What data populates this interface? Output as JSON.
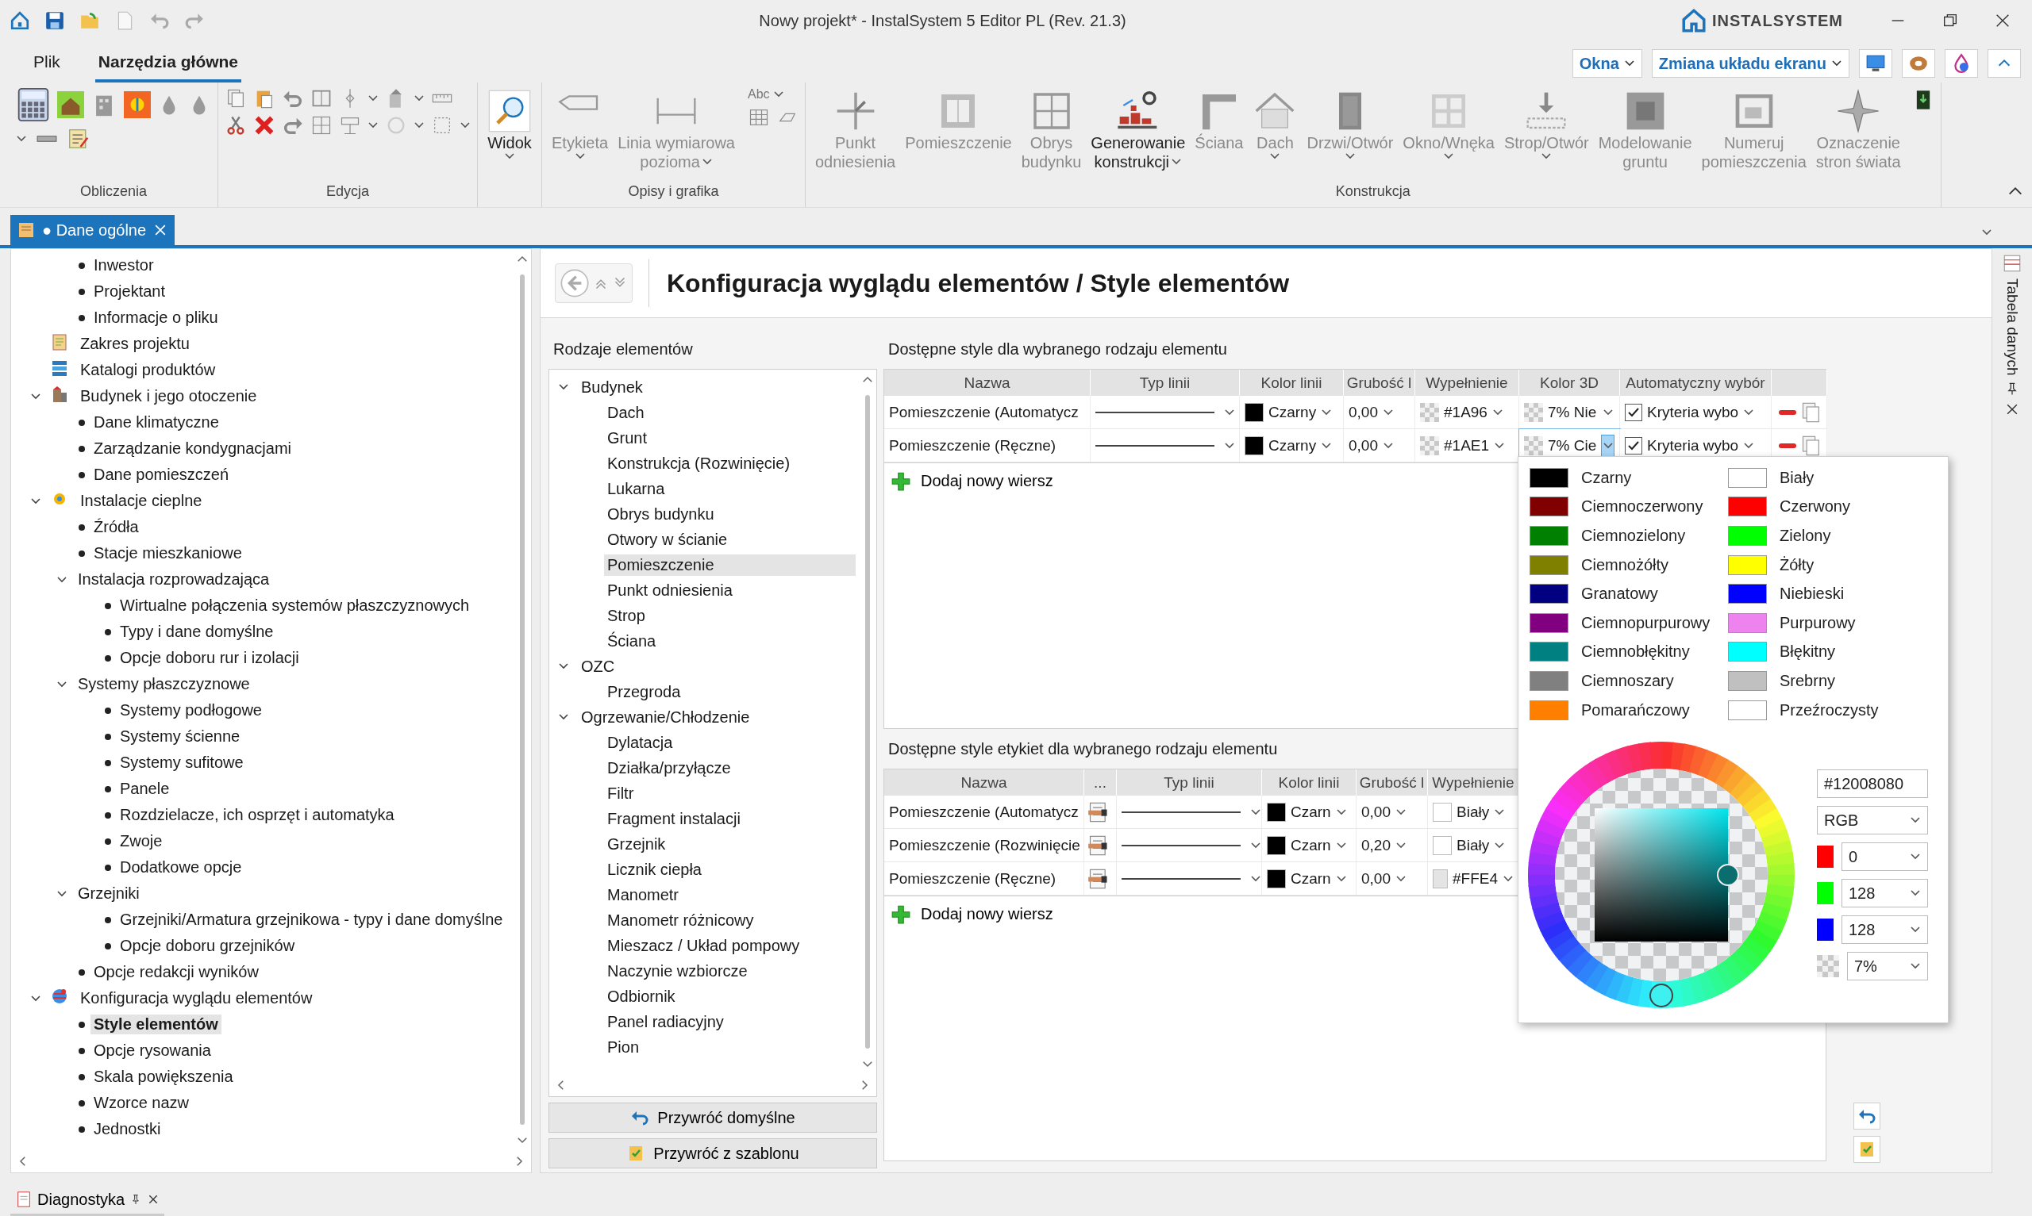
{
  "window": {
    "title": "Nowy projekt* - InstalSystem 5 Editor PL (Rev. 21.3)",
    "brand": "INSTALSYSTEM"
  },
  "menu_tabs": [
    {
      "label": "Plik",
      "selected": false
    },
    {
      "label": "Narzędzia główne",
      "selected": true
    }
  ],
  "ribbon_dropdowns": [
    {
      "label": "Okna"
    },
    {
      "label": "Zmiana układu ekranu"
    }
  ],
  "ribbon_groups": [
    {
      "kind": "calculations",
      "label": "Obliczenia"
    },
    {
      "kind": "editing",
      "label": "Edycja"
    },
    {
      "kind": "view",
      "buttons": [
        {
          "lines": [
            "Widok"
          ],
          "disabled": false,
          "dropdown": true
        }
      ]
    },
    {
      "kind": "annotations",
      "label": "Opisy i grafika",
      "text_tool": "Abc",
      "buttons": [
        {
          "lines": [
            "Etykieta"
          ],
          "disabled": true,
          "dropdown": true
        },
        {
          "lines": [
            "Linia wymiarowa",
            "pozioma"
          ],
          "disabled": true,
          "dropdown": true
        }
      ]
    },
    {
      "kind": "construction",
      "label": "Konstrukcja",
      "buttons": [
        {
          "lines": [
            "Punkt",
            "odniesienia"
          ],
          "disabled": true,
          "dropdown": false
        },
        {
          "lines": [
            "Pomieszczenie"
          ],
          "disabled": true,
          "dropdown": false
        },
        {
          "lines": [
            "Obrys",
            "budynku"
          ],
          "disabled": true,
          "dropdown": false
        },
        {
          "lines": [
            "Generowanie",
            "konstrukcji"
          ],
          "disabled": false,
          "dropdown": true
        },
        {
          "lines": [
            "Ściana"
          ],
          "disabled": true,
          "dropdown": false
        },
        {
          "lines": [
            "Dach"
          ],
          "disabled": true,
          "dropdown": true
        },
        {
          "lines": [
            "Drzwi/Otwór"
          ],
          "disabled": true,
          "dropdown": true
        },
        {
          "lines": [
            "Okno/Wnęka"
          ],
          "disabled": true,
          "dropdown": true
        },
        {
          "lines": [
            "Strop/Otwór"
          ],
          "disabled": true,
          "dropdown": true
        },
        {
          "lines": [
            "Modelowanie",
            "gruntu"
          ],
          "disabled": true,
          "dropdown": false
        },
        {
          "lines": [
            "Numeruj",
            "pomieszczenia"
          ],
          "disabled": true,
          "dropdown": false
        },
        {
          "lines": [
            "Oznaczenie",
            "stron świata"
          ],
          "disabled": true,
          "dropdown": false
        }
      ]
    }
  ],
  "document_tab": {
    "label": "● Dane ogólne",
    "selected": true
  },
  "tree": [
    {
      "children": [
        {
          "label": "Inwestor",
          "selected": false
        },
        {
          "label": "Projektant",
          "selected": false
        },
        {
          "label": "Informacje o pliku",
          "selected": false
        }
      ]
    },
    {
      "label": "Zakres projektu",
      "selected": false
    },
    {
      "label": "Katalogi produktów",
      "selected": false
    },
    {
      "label": "Budynek i jego otoczenie",
      "selected": false,
      "expanded": true,
      "children": [
        {
          "label": "Dane klimatyczne",
          "selected": false
        },
        {
          "label": "Zarządzanie kondygnacjami",
          "selected": false
        },
        {
          "label": "Dane pomieszczeń",
          "selected": false
        }
      ]
    },
    {
      "label": "Instalacje cieplne",
      "selected": false,
      "expanded": true,
      "children": [
        {
          "label": "Źródła",
          "selected": false
        },
        {
          "label": "Stacje mieszkaniowe",
          "selected": false
        },
        {
          "label": "Instalacja rozprowadzająca",
          "selected": false,
          "expanded": true,
          "children": [
            {
              "label": "Wirtualne połączenia systemów płaszczyznowych",
              "selected": false
            },
            {
              "label": "Typy i dane domyślne",
              "selected": false
            },
            {
              "label": "Opcje doboru rur i izolacji",
              "selected": false
            }
          ]
        },
        {
          "label": "Systemy płaszczyznowe",
          "selected": false,
          "expanded": true,
          "children": [
            {
              "label": "Systemy podłogowe",
              "selected": false
            },
            {
              "label": "Systemy ścienne",
              "selected": false
            },
            {
              "label": "Systemy sufitowe",
              "selected": false
            },
            {
              "label": "Panele",
              "selected": false
            },
            {
              "label": "Rozdzielacze, ich osprzęt i automatyka",
              "selected": false
            },
            {
              "label": "Zwoje",
              "selected": false
            },
            {
              "label": "Dodatkowe opcje",
              "selected": false
            }
          ]
        },
        {
          "label": "Grzejniki",
          "selected": false,
          "expanded": true,
          "children": [
            {
              "label": "Grzejniki/Armatura grzejnikowa - typy i dane domyślne",
              "selected": false
            },
            {
              "label": "Opcje doboru grzejników",
              "selected": false
            }
          ]
        },
        {
          "label": "Opcje redakcji wyników",
          "selected": false
        }
      ]
    },
    {
      "label": "Konfiguracja wyglądu elementów",
      "selected": false,
      "expanded": true,
      "children": [
        {
          "label": "Style elementów",
          "selected": true
        },
        {
          "label": "Opcje rysowania",
          "selected": false
        },
        {
          "label": "Skala powiększenia",
          "selected": false
        },
        {
          "label": "Wzorce nazw",
          "selected": false
        },
        {
          "label": "Jednostki",
          "selected": false
        }
      ]
    }
  ],
  "page": {
    "title": "Konfiguracja wyglądu elementów / Style elementów"
  },
  "element_types": {
    "title": "Rodzaje elementów",
    "items": [
      {
        "label": "Budynek",
        "selected": false,
        "expanded": true,
        "children": [
          {
            "label": "Dach",
            "selected": false
          },
          {
            "label": "Grunt",
            "selected": false
          },
          {
            "label": "Konstrukcja (Rozwinięcie)",
            "selected": false
          },
          {
            "label": "Lukarna",
            "selected": false
          },
          {
            "label": "Obrys budynku",
            "selected": false
          },
          {
            "label": "Otwory w ścianie",
            "selected": false
          },
          {
            "label": "Pomieszczenie",
            "selected": true
          },
          {
            "label": "Punkt odniesienia",
            "selected": false
          },
          {
            "label": "Strop",
            "selected": false
          },
          {
            "label": "Ściana",
            "selected": false
          }
        ]
      },
      {
        "label": "OZC",
        "selected": false,
        "expanded": true,
        "children": [
          {
            "label": "Przegroda",
            "selected": false
          }
        ]
      },
      {
        "label": "Ogrzewanie/Chłodzenie",
        "selected": false,
        "expanded": true,
        "children": [
          {
            "label": "Dylatacja",
            "selected": false
          },
          {
            "label": "Działka/przyłącze",
            "selected": false
          },
          {
            "label": "Filtr",
            "selected": false
          },
          {
            "label": "Fragment instalacji",
            "selected": false
          },
          {
            "label": "Grzejnik",
            "selected": false
          },
          {
            "label": "Licznik ciepła",
            "selected": false
          },
          {
            "label": "Manometr",
            "selected": false
          },
          {
            "label": "Manometr różnicowy",
            "selected": false
          },
          {
            "label": "Mieszacz / Układ pompowy",
            "selected": false
          },
          {
            "label": "Naczynie wzbiorcze",
            "selected": false
          },
          {
            "label": "Odbiornik",
            "selected": false
          },
          {
            "label": "Panel radiacyjny",
            "selected": false
          },
          {
            "label": "Pion",
            "selected": false
          }
        ]
      }
    ]
  },
  "restore_buttons": [
    {
      "label": "Przywróć domyślne"
    },
    {
      "label": "Przywróć z szablonu"
    }
  ],
  "styles": {
    "title": "Dostępne style dla wybranego rodzaju elementu",
    "columns": [
      "Nazwa",
      "Typ linii",
      "Kolor linii",
      "Grubość l",
      "Wypełnienie",
      "Kolor 3D",
      "Automatyczny wybór"
    ],
    "rows": [
      {
        "name": "Pomieszczenie (Automatycz",
        "line_color": {
          "text": "Czarny",
          "color": "#000000"
        },
        "thickness": "0,00",
        "fill": {
          "text": "#1A96",
          "kind": "transparent"
        },
        "color_3d": {
          "text": "7% Nie",
          "kind": "transparent",
          "open": false
        },
        "auto": {
          "checked": true,
          "text": "Kryteria wybo"
        }
      },
      {
        "name": "Pomieszczenie (Ręczne)",
        "line_color": {
          "text": "Czarny",
          "color": "#000000"
        },
        "thickness": "0,00",
        "fill": {
          "text": "#1AE1",
          "kind": "transparent"
        },
        "color_3d": {
          "text": "7% Cie",
          "kind": "transparent",
          "open": true
        },
        "auto": {
          "checked": true,
          "text": "Kryteria wybo"
        }
      }
    ],
    "add_row": "Dodaj nowy wiersz"
  },
  "label_styles": {
    "title": "Dostępne style etykiet dla wybranego rodzaju elementu",
    "columns": [
      "Nazwa",
      "...",
      "Typ linii",
      "Kolor linii",
      "Grubość l",
      "Wypełnienie"
    ],
    "rows": [
      {
        "name": "Pomieszczenie (Automatycz",
        "line_color": {
          "text": "Czarn",
          "color": "#000000"
        },
        "thickness": "0,00",
        "fill": {
          "text": "Biały",
          "color": "#ffffff"
        }
      },
      {
        "name": "Pomieszczenie (Rozwinięcie",
        "line_color": {
          "text": "Czarn",
          "color": "#000000"
        },
        "thickness": "0,20",
        "fill": {
          "text": "Biały",
          "color": "#ffffff"
        }
      },
      {
        "name": "Pomieszczenie (Ręczne)",
        "line_color": {
          "text": "Czarn",
          "color": "#000000"
        },
        "thickness": "0,00",
        "fill": {
          "text": "#FFE4",
          "color": "#e4e4e4"
        }
      }
    ],
    "add_row": "Dodaj nowy wiersz"
  },
  "color_picker": {
    "colors": [
      {
        "name": "Czarny",
        "color": "#000000",
        "selected": false
      },
      {
        "name": "Biały",
        "color": "#ffffff",
        "selected": false
      },
      {
        "name": "Ciemnoczerwony",
        "color": "#800000",
        "selected": false
      },
      {
        "name": "Czerwony",
        "color": "#ff0000",
        "selected": false
      },
      {
        "name": "Ciemnozielony",
        "color": "#008000",
        "selected": false
      },
      {
        "name": "Zielony",
        "color": "#00ff00",
        "selected": false
      },
      {
        "name": "Ciemnożółty",
        "color": "#808000",
        "selected": false
      },
      {
        "name": "Żółty",
        "color": "#ffff00",
        "selected": false
      },
      {
        "name": "Granatowy",
        "color": "#000080",
        "selected": false
      },
      {
        "name": "Niebieski",
        "color": "#0000ff",
        "selected": false
      },
      {
        "name": "Ciemnopurpurowy",
        "color": "#800080",
        "selected": false
      },
      {
        "name": "Purpurowy",
        "color": "#ee82ee",
        "selected": false
      },
      {
        "name": "Ciemnobłękitny",
        "color": "#008080",
        "selected": false
      },
      {
        "name": "Błękitny",
        "color": "#00ffff",
        "selected": false
      },
      {
        "name": "Ciemnoszary",
        "color": "#808080",
        "selected": false
      },
      {
        "name": "Srebrny",
        "color": "#c0c0c0",
        "selected": false
      },
      {
        "name": "Pomarańczowy",
        "color": "#ff8000",
        "selected": false
      },
      {
        "name": "Przeźroczysty",
        "color": "#ffffff",
        "selected": false
      }
    ],
    "hex": "#12008080",
    "mode": "RGB",
    "channels": [
      {
        "kind": "red",
        "color": "#ff0000",
        "value": "0"
      },
      {
        "kind": "green",
        "color": "#00ff00",
        "value": "128"
      },
      {
        "kind": "blue",
        "color": "#0000ff",
        "value": "128"
      },
      {
        "kind": "alpha",
        "value": "7%"
      }
    ]
  },
  "side_panel": {
    "title": "Tabela danych"
  },
  "status_bar": {
    "tabs": [
      {
        "label": "Diagnostyka"
      }
    ]
  }
}
